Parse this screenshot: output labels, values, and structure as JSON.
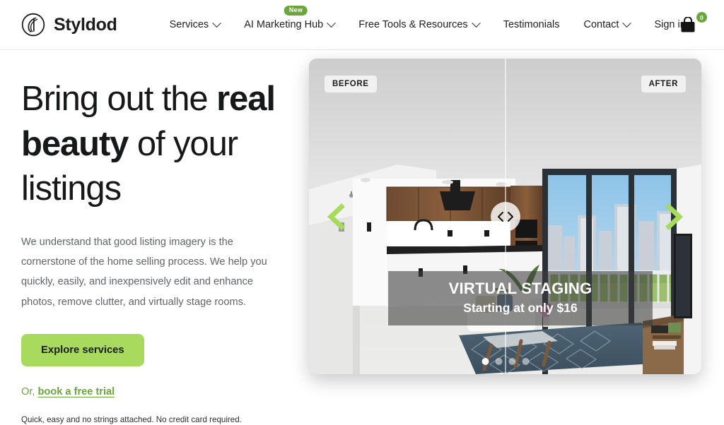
{
  "header": {
    "brand": {
      "name": "Styldod",
      "logo_icon": "styldod-spiral-logo-icon"
    },
    "nav": [
      {
        "label": "Services",
        "has_caret": true,
        "badge": ""
      },
      {
        "label": "AI Marketing Hub",
        "has_caret": true,
        "badge": "New"
      },
      {
        "label": "Free Tools & Resources",
        "has_caret": true,
        "badge": ""
      },
      {
        "label": "Testimonials",
        "has_caret": false,
        "badge": ""
      },
      {
        "label": "Contact",
        "has_caret": true,
        "badge": ""
      },
      {
        "label": "Sign in",
        "has_caret": false,
        "badge": ""
      }
    ],
    "cart": {
      "icon": "shopping-bag-icon",
      "count": "0"
    }
  },
  "hero": {
    "headline_part1": "Bring out the ",
    "headline_bold": "real beauty",
    "headline_part2": " of your listings",
    "paragraph": "We understand that good listing imagery is the cornerstone of the home selling process. We help you quickly, easily, and inexpensively edit and enhance photos, remove clutter, and virtually stage rooms.",
    "cta_label": "Explore services",
    "or_prefix": "Or, ",
    "or_link": "book a free trial",
    "fineprint": "Quick, easy and no strings attached. No credit card required."
  },
  "showcase": {
    "before_label": "BEFORE",
    "after_label": "AFTER",
    "prev_icon": "chevron-left-icon",
    "next_icon": "chevron-right-icon",
    "handle_icon": "slider-handle-left-right-icon",
    "caption_title": "VIRTUAL STAGING",
    "caption_sub": "Starting at only $16",
    "dots": [
      {
        "active": true
      },
      {
        "active": false
      },
      {
        "active": false
      },
      {
        "active": false
      }
    ]
  },
  "colors": {
    "brand_green": "#6aa63b",
    "cta_green": "#a8da5e",
    "text_dark": "#17181a",
    "text_muted": "#616468"
  }
}
